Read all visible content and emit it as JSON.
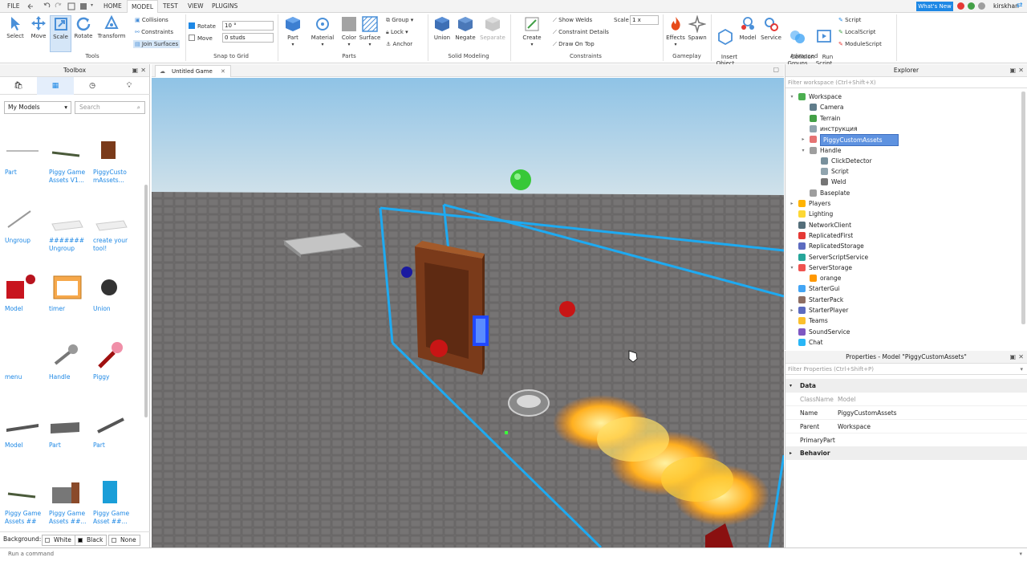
{
  "menu": {
    "file": "FILE",
    "tabs": [
      "HOME",
      "MODEL",
      "TEST",
      "VIEW",
      "PLUGINS"
    ],
    "active_tab": "MODEL",
    "whats_new": "What's New",
    "user": "kirskhan"
  },
  "ribbon": {
    "tools": {
      "title": "Tools",
      "buttons": [
        "Select",
        "Move",
        "Scale",
        "Rotate",
        "Transform"
      ],
      "selected": "Scale",
      "options": [
        "Collisions",
        "Constraints",
        "Join Surfaces"
      ]
    },
    "snap": {
      "title": "Snap to Grid",
      "rotate_label": "Rotate",
      "rotate_value": "10 °",
      "rotate_checked": true,
      "move_label": "Move",
      "move_value": "0 studs",
      "move_checked": false
    },
    "parts": {
      "title": "Parts",
      "buttons": [
        "Part",
        "Material",
        "Color",
        "Surface"
      ],
      "options": [
        "Group",
        "Lock",
        "Anchor"
      ]
    },
    "solid": {
      "title": "Solid Modeling",
      "buttons": [
        "Union",
        "Negate",
        "Separate"
      ]
    },
    "constraints": {
      "title": "Constraints",
      "create": "Create",
      "options": [
        "Show Welds",
        "Constraint Details",
        "Draw On Top"
      ],
      "scale_label": "Scale",
      "scale_value": "1 x"
    },
    "gameplay": {
      "title": "Gameplay",
      "buttons": [
        "Effects",
        "Spawn"
      ]
    },
    "advanced": {
      "title": "Advanced",
      "buttons": [
        "Insert\nObject",
        "Model",
        "Service",
        "Collision\nGroups",
        "Run\nScript"
      ],
      "scripts": [
        "Script",
        "LocalScript",
        "ModuleScript"
      ]
    }
  },
  "toolbox": {
    "title": "Toolbox",
    "category": "My Models",
    "search_placeholder": "Search",
    "items": [
      {
        "label": "Part"
      },
      {
        "label": "Piggy Game\nAssets V1..."
      },
      {
        "label": "PiggyCusto\nmAssets..."
      },
      {
        "label": "Ungroup"
      },
      {
        "label": "#######\nUngroup"
      },
      {
        "label": "create your\ntool!"
      },
      {
        "label": "Model"
      },
      {
        "label": "timer"
      },
      {
        "label": "Union"
      },
      {
        "label": "menu"
      },
      {
        "label": "Handle"
      },
      {
        "label": "Piggy"
      },
      {
        "label": "Model"
      },
      {
        "label": "Part"
      },
      {
        "label": "Part"
      },
      {
        "label": "Piggy Game\nAssets ##"
      },
      {
        "label": "Piggy Game\nAssets ##..."
      },
      {
        "label": "Piggy Game\nAsset ##..."
      }
    ],
    "background_label": "Background:",
    "background_options": [
      "White",
      "Black",
      "None"
    ]
  },
  "document": {
    "tab": "Untitled Game"
  },
  "explorer": {
    "title": "Explorer",
    "filter_placeholder": "Filter workspace (Ctrl+Shift+X)",
    "items": [
      {
        "label": "Workspace",
        "depth": 0,
        "arrow": "open",
        "color": "#4caf50"
      },
      {
        "label": "Camera",
        "depth": 1,
        "arrow": "",
        "color": "#607d8b"
      },
      {
        "label": "Terrain",
        "depth": 1,
        "arrow": "",
        "color": "#43a047"
      },
      {
        "label": "инструкция",
        "depth": 1,
        "arrow": "",
        "color": "#90a4ae"
      },
      {
        "label": "PiggyCustomAssets",
        "depth": 1,
        "arrow": "closed",
        "color": "#e57373",
        "selected": true
      },
      {
        "label": "Handle",
        "depth": 1,
        "arrow": "open",
        "color": "#9e9e9e"
      },
      {
        "label": "ClickDetector",
        "depth": 2,
        "arrow": "",
        "color": "#78909c"
      },
      {
        "label": "Script",
        "depth": 2,
        "arrow": "",
        "color": "#90a4ae"
      },
      {
        "label": "Weld",
        "depth": 2,
        "arrow": "",
        "color": "#757575"
      },
      {
        "label": "Baseplate",
        "depth": 1,
        "arrow": "",
        "color": "#9e9e9e"
      },
      {
        "label": "Players",
        "depth": 0,
        "arrow": "closed",
        "color": "#ffb300"
      },
      {
        "label": "Lighting",
        "depth": 0,
        "arrow": "",
        "color": "#fdd835"
      },
      {
        "label": "NetworkClient",
        "depth": 0,
        "arrow": "",
        "color": "#546e7a"
      },
      {
        "label": "ReplicatedFirst",
        "depth": 0,
        "arrow": "",
        "color": "#e53935"
      },
      {
        "label": "ReplicatedStorage",
        "depth": 0,
        "arrow": "",
        "color": "#5c6bc0"
      },
      {
        "label": "ServerScriptService",
        "depth": 0,
        "arrow": "",
        "color": "#26a69a"
      },
      {
        "label": "ServerStorage",
        "depth": 0,
        "arrow": "open",
        "color": "#ef5350"
      },
      {
        "label": "orange",
        "depth": 1,
        "arrow": "",
        "color": "#ff9800"
      },
      {
        "label": "StarterGui",
        "depth": 0,
        "arrow": "",
        "color": "#42a5f5"
      },
      {
        "label": "StarterPack",
        "depth": 0,
        "arrow": "",
        "color": "#8d6e63"
      },
      {
        "label": "StarterPlayer",
        "depth": 0,
        "arrow": "closed",
        "color": "#5c6bc0"
      },
      {
        "label": "Teams",
        "depth": 0,
        "arrow": "",
        "color": "#fbc02d"
      },
      {
        "label": "SoundService",
        "depth": 0,
        "arrow": "",
        "color": "#7e57c2"
      },
      {
        "label": "Chat",
        "depth": 0,
        "arrow": "",
        "color": "#29b6f6"
      }
    ]
  },
  "properties": {
    "title": "Properties - Model \"PiggyCustomAssets\"",
    "filter_placeholder": "Filter Properties (Ctrl+Shift+P)",
    "data_label": "Data",
    "rows": [
      {
        "key": "ClassName",
        "value": "Model",
        "muted": true
      },
      {
        "key": "Name",
        "value": "PiggyCustomAssets",
        "muted": false
      },
      {
        "key": "Parent",
        "value": "Workspace",
        "muted": false
      },
      {
        "key": "PrimaryPart",
        "value": "",
        "muted": false
      }
    ],
    "behavior_label": "Behavior"
  },
  "command": {
    "placeholder": "Run a command"
  }
}
